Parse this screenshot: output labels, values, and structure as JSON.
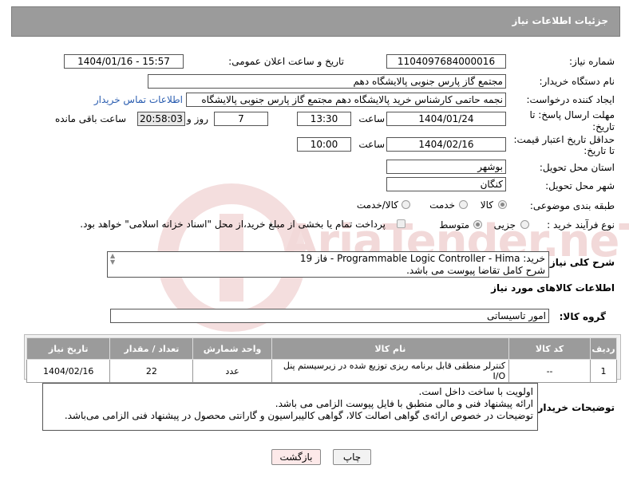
{
  "header": {
    "title": "جزئیات اطلاعات نیاز"
  },
  "need_number": {
    "label": "شماره نیاز:",
    "value": "1104097684000016"
  },
  "announce": {
    "label": "تاریخ و ساعت اعلان عمومی:",
    "value": "1404/01/16 - 15:57"
  },
  "buyer_org": {
    "label": "نام دستگاه خریدار:",
    "value": "مجتمع گاز پارس جنوبی  پالایشگاه دهم"
  },
  "requester": {
    "label": "ایجاد کننده درخواست:",
    "value": "نجمه حاتمی کارشناس خرید پالایشگاه دهم  مجتمع گاز پارس جنوبی  پالایشگاه",
    "link": "اطلاعات تماس خریدار"
  },
  "deadline": {
    "label1": "مهلت ارسال پاسخ: تا",
    "label2": "تاریخ:",
    "date": "1404/01/24",
    "time_label": "ساعت",
    "time": "13:30",
    "days": "7",
    "days_label": "روز و",
    "remain": "20:58:03",
    "remain_label": "ساعت باقی مانده"
  },
  "validity": {
    "label1": "حداقل تاریخ اعتبار قیمت:",
    "label2": "تا تاریخ:",
    "date": "1404/02/16",
    "time_label": "ساعت",
    "time": "10:00"
  },
  "province": {
    "label": "استان محل تحویل:",
    "value": "بوشهر"
  },
  "city": {
    "label": "شهر محل تحویل:",
    "value": "کنگان"
  },
  "category": {
    "label": "طبقه بندی موضوعی:",
    "options": [
      "کالا",
      "خدمت",
      "کالا/خدمت"
    ]
  },
  "process": {
    "label": "نوع فرآیند خرید :",
    "options": [
      "جزیی",
      "متوسط"
    ],
    "note": "پرداخت تمام یا بخشی از مبلغ خرید،از محل \"اسناد خزانه اسلامی\" خواهد بود."
  },
  "description": {
    "label": "شرح کلی نیاز:",
    "line1": "خرید: Programmable Logic Controller - Hima - فاز 19",
    "line2": "شرح کامل تقاضا پیوست می باشد."
  },
  "goods_info": {
    "title": "اطلاعات کالاهای مورد نیاز"
  },
  "goods_group": {
    "label": "گروه کالا:",
    "value": "امور تاسیساتی"
  },
  "table": {
    "headers": [
      "ردیف",
      "کد کالا",
      "نام کالا",
      "واحد شمارش",
      "تعداد / مقدار",
      "تاریخ نیاز"
    ],
    "rows": [
      [
        "1",
        "--",
        "کنترلر منطقی قابل برنامه ریزی توزیع شده در زیرسیستم پنل I/O",
        "عدد",
        "22",
        "1404/02/16"
      ]
    ]
  },
  "buyer_notes": {
    "label": "توضیحات خریدار:",
    "line1": "اولویت با ساخت داخل است.",
    "line2": "ارائه پیشنهاد فنی و مالی منطبق با فایل پیوست الزامی می باشد.",
    "line3": "توضیحات در خصوص ارائه‌ی گواهی اصالت کالا، گواهی کالیبراسیون و گارانتی محصول در پیشنهاد فنی الزامی می‌باشد."
  },
  "buttons": {
    "print": "چاپ",
    "back": "بازگشت"
  },
  "watermark": "AriaTender.neT",
  "colors": {
    "header_bg": "#9b9b9b",
    "link": "#2a5db0",
    "back_button": "#fde9e9"
  }
}
